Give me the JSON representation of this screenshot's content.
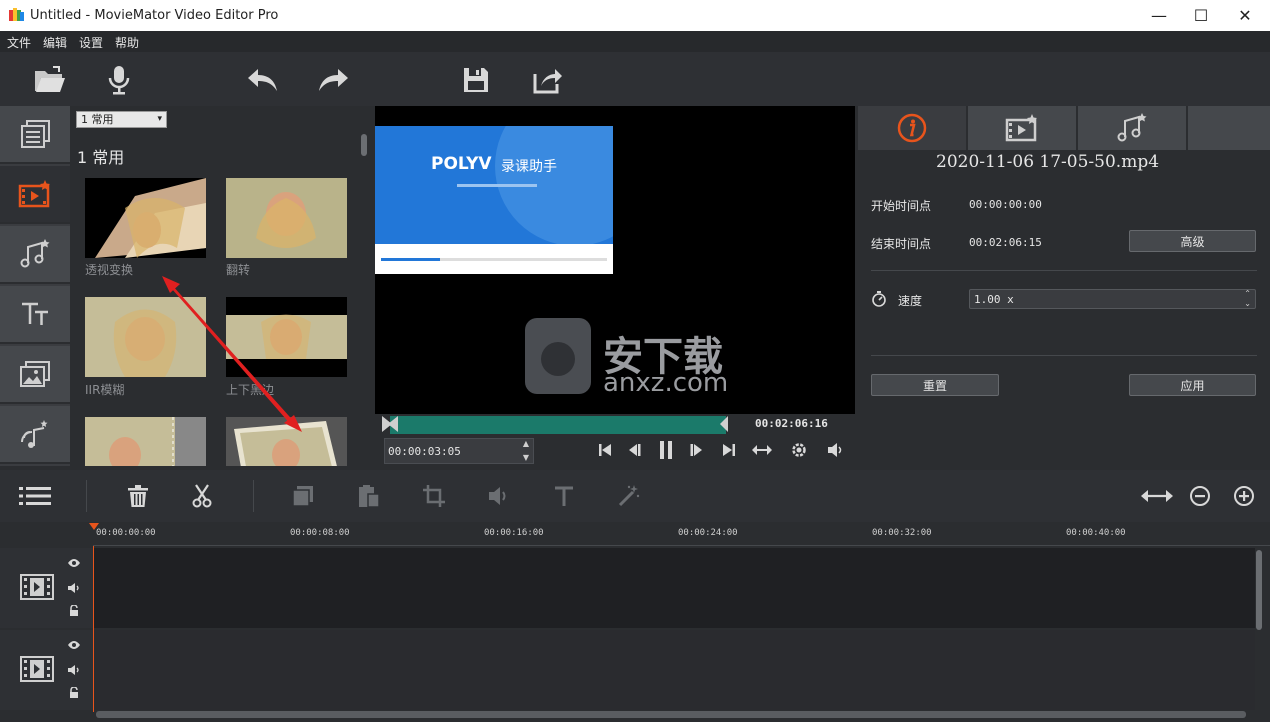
{
  "window": {
    "title": "Untitled - MovieMator Video Editor Pro",
    "minimize": "—",
    "maximize": "☐",
    "close": "✕"
  },
  "menu": [
    "文件",
    "编辑",
    "设置",
    "帮助"
  ],
  "effects": {
    "category_select": "1 常用",
    "category_heading": "1  常用",
    "items": [
      {
        "label": "透视变换"
      },
      {
        "label": "翻转"
      },
      {
        "label": "IIR模糊"
      },
      {
        "label": "上下黑边"
      },
      {
        "label": ""
      },
      {
        "label": ""
      }
    ]
  },
  "preview": {
    "brand": "POLYV",
    "brand_sub": "录课助手",
    "watermark_cn": "安下载",
    "watermark_en": "anxz.com",
    "duration": "00:02:06:16",
    "current_time": "00:00:03:05"
  },
  "info": {
    "filename": "2020-11-06  17-05-50.mp4",
    "start_label": "开始时间点",
    "start_value": "00:00:00:00",
    "end_label": "结束时间点",
    "end_value": "00:02:06:15",
    "advanced_button": "高级",
    "speed_label": "速度",
    "speed_value": "1.00 x",
    "reset_button": "重置",
    "apply_button": "应用"
  },
  "ruler_ticks": [
    "00:00:00:00",
    "00:00:08:00",
    "00:00:16:00",
    "00:00:24:00",
    "00:00:32:00",
    "00:00:40:00"
  ],
  "colors": {
    "accent": "#e8541c",
    "progress": "#1b7a6a",
    "playhead": "#e8541c"
  }
}
